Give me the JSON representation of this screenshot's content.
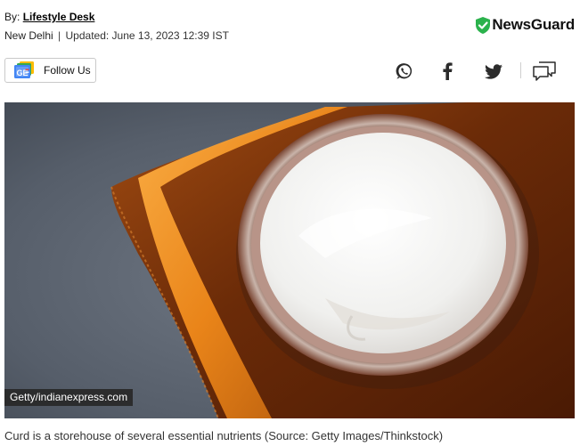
{
  "byline": {
    "prefix": "By:",
    "author": "Lifestyle Desk"
  },
  "meta": {
    "location": "New Delhi",
    "separator": "|",
    "updated": "Updated: June 13, 2023 12:39 IST"
  },
  "newsguard": {
    "label": "NewsGuard",
    "shield_color": "#2bb24c"
  },
  "follow": {
    "icon": "google-news-icon",
    "label": "Follow Us"
  },
  "share": {
    "whatsapp_icon": "whatsapp-icon",
    "facebook_icon": "facebook-icon",
    "twitter_icon": "twitter-icon",
    "comments_icon": "comments-icon"
  },
  "hero_image": {
    "subject": "bowl of curd on orange cloth",
    "credit": "Getty/indianexpress.com"
  },
  "caption": "Curd is a storehouse of several essential nutrients (Source: Getty Images/Thinkstock)"
}
